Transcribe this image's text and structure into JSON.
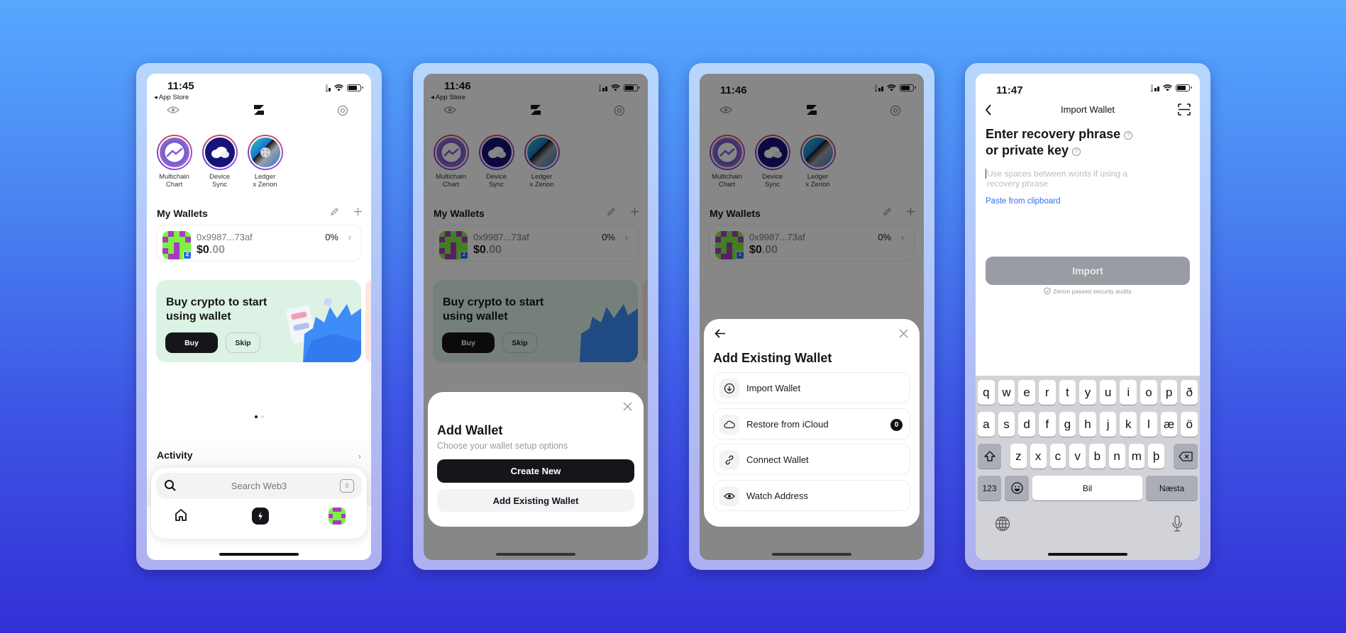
{
  "colors": {
    "accent_blue": "#2f6fe8",
    "primary_dark": "#16161a",
    "promo_bg": "#dcf2e4",
    "avatar_green": "#7ef040",
    "avatar_purple": "#a83bc0"
  },
  "screens": [
    {
      "status": {
        "time": "11:45",
        "back_app": "◂ App Store"
      },
      "topnav": {
        "left_icon": "eye-icon",
        "center_icon": "zerion-logo-icon",
        "right_icon": "at-sign-icon"
      },
      "stories": [
        {
          "label_line1": "Multichain",
          "label_line2": "Chart",
          "icon": "chart-icon"
        },
        {
          "label_line1": "Device",
          "label_line2": "Sync",
          "icon": "cloud-icon"
        },
        {
          "label_line1": "Ledger",
          "label_line2": "x Zerion",
          "icon": "ledger-icon"
        }
      ],
      "wallets": {
        "title": "My Wallets",
        "items": [
          {
            "address": "0x9987...73af",
            "balance_main": "$0",
            "balance_cents": ".00",
            "change": "0%"
          }
        ]
      },
      "promo": {
        "title": "Buy crypto to start using wallet",
        "buy_label": "Buy",
        "skip_label": "Skip",
        "page": 1,
        "pages": 2
      },
      "activity": {
        "title": "Activity"
      },
      "dock": {
        "search_placeholder": "Search Web3",
        "tab_count": "0"
      }
    },
    {
      "status": {
        "time": "11:46",
        "back_app": "◂ App Store"
      },
      "sheet": {
        "title": "Add Wallet",
        "subtitle": "Choose your wallet setup options",
        "create_label": "Create New",
        "existing_label": "Add Existing Wallet"
      }
    },
    {
      "status": {
        "time": "11:46"
      },
      "sheet": {
        "title": "Add Existing Wallet",
        "options": [
          {
            "label": "Import Wallet",
            "icon": "download-circle-icon"
          },
          {
            "label": "Restore from iCloud",
            "icon": "cloud-icon",
            "badge": "0"
          },
          {
            "label": "Connect Wallet",
            "icon": "link-icon"
          },
          {
            "label": "Watch Address",
            "icon": "eye-icon"
          }
        ]
      }
    },
    {
      "status": {
        "time": "11:47"
      },
      "nav": {
        "title": "Import Wallet"
      },
      "heading_line1": "Enter recovery phrase",
      "heading_line2": "or private key",
      "input": {
        "value": "",
        "placeholder": "Use spaces between words if using a recovery phrase"
      },
      "paste_label": "Paste from clipboard",
      "import_label": "Import",
      "audit_text": "Zerion passed security audits",
      "keyboard": {
        "row1": [
          "q",
          "w",
          "e",
          "r",
          "t",
          "y",
          "u",
          "i",
          "o",
          "p",
          "ð"
        ],
        "row2": [
          "a",
          "s",
          "d",
          "f",
          "g",
          "h",
          "j",
          "k",
          "l",
          "æ",
          "ö"
        ],
        "row3": [
          "z",
          "x",
          "c",
          "v",
          "b",
          "n",
          "m",
          "þ"
        ],
        "numbers_label": "123",
        "space_label": "Bil",
        "return_label": "Næsta"
      }
    }
  ]
}
